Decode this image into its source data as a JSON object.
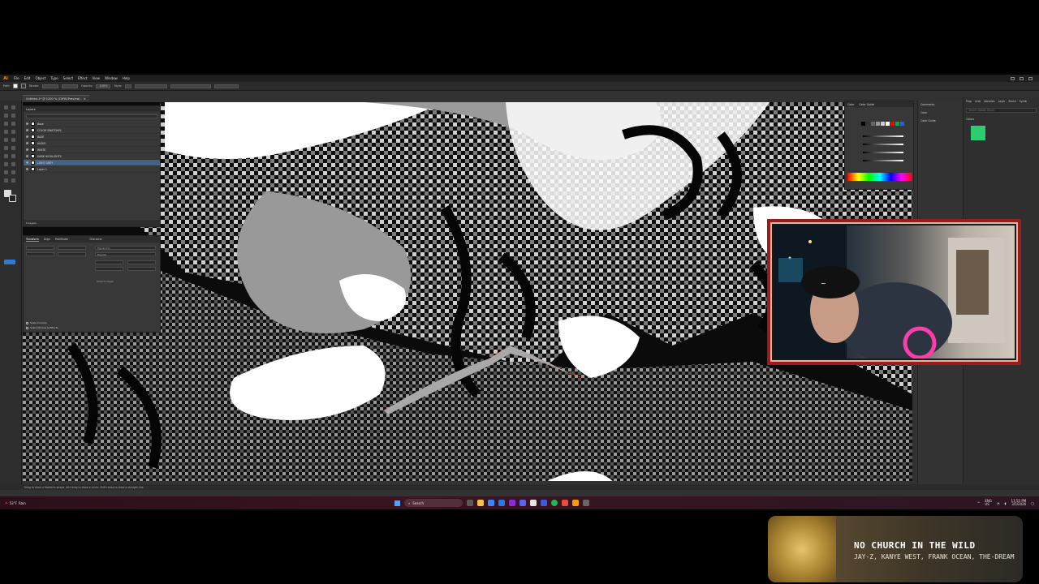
{
  "menubar": {
    "logo": "Ai",
    "items": [
      "File",
      "Edit",
      "Object",
      "Type",
      "Select",
      "Effect",
      "View",
      "Window",
      "Help"
    ]
  },
  "control_bar": {
    "path_label": "Path",
    "stroke_label": "Stroke:",
    "opacity_label": "Opacity:",
    "opacity_value": "100%",
    "style_label": "Style:"
  },
  "document_tab": {
    "title": "Untitled-1* @ 1200 % (CMYK/Preview)",
    "close": "×"
  },
  "layers_panel": {
    "title": "Layers",
    "layers": [
      {
        "name": "Base",
        "selected": false
      },
      {
        "name": "COLOR SWATCHES",
        "selected": false
      },
      {
        "name": "BASE",
        "selected": false
      },
      {
        "name": "AUDIO",
        "selected": false
      },
      {
        "name": "WHITE",
        "selected": false
      },
      {
        "name": "DARK HIGHLIGHTS",
        "selected": false
      },
      {
        "name": "LIGHT GREY",
        "selected": true
      },
      {
        "name": "Layer 1",
        "selected": false
      }
    ],
    "footer": "5 Layers"
  },
  "properties_panel": {
    "tabs": [
      "Transform",
      "Align",
      "Pathfinder"
    ],
    "char_tab": "Character",
    "font": "Myriad Pro",
    "style": "Regular",
    "snap": "Snap to Glyph",
    "options": [
      "Scale Corners",
      "Scale Strokes & Effects"
    ]
  },
  "color_panel": {
    "tabs": [
      "Color",
      "Color Guide"
    ],
    "swatches": [
      "#000000",
      "#333333",
      "#666666",
      "#999999",
      "#cccccc",
      "#ffffff",
      "#ff0000",
      "#00aa55",
      "#2266cc"
    ]
  },
  "comments_panel": {
    "items": [
      "Comments",
      "Color",
      "Color Guide"
    ]
  },
  "libraries_panel": {
    "tabs": [
      "Prop",
      "Artb",
      "Libraries",
      "Layer",
      "Brush",
      "Symb"
    ],
    "search_placeholder": "Search Adobe Stock",
    "section": "Colors",
    "color": "#2ecc71"
  },
  "statusbar": {
    "text": "Drag to draw a freeform shape. Alt+drag to draw a circle. Shift+drag to draw a straight line."
  },
  "taskbar": {
    "weather_temp": "53°F",
    "weather_label": "Rain",
    "search_label": "Search",
    "lang": "ENG",
    "region": "US",
    "time": "11:55 PM",
    "date": "3/5/2026"
  },
  "now_playing": {
    "title": "NO CHURCH IN THE WILD",
    "artist": "JAY-Z, KANYE WEST, FRANK OCEAN, THE-DREAM"
  }
}
